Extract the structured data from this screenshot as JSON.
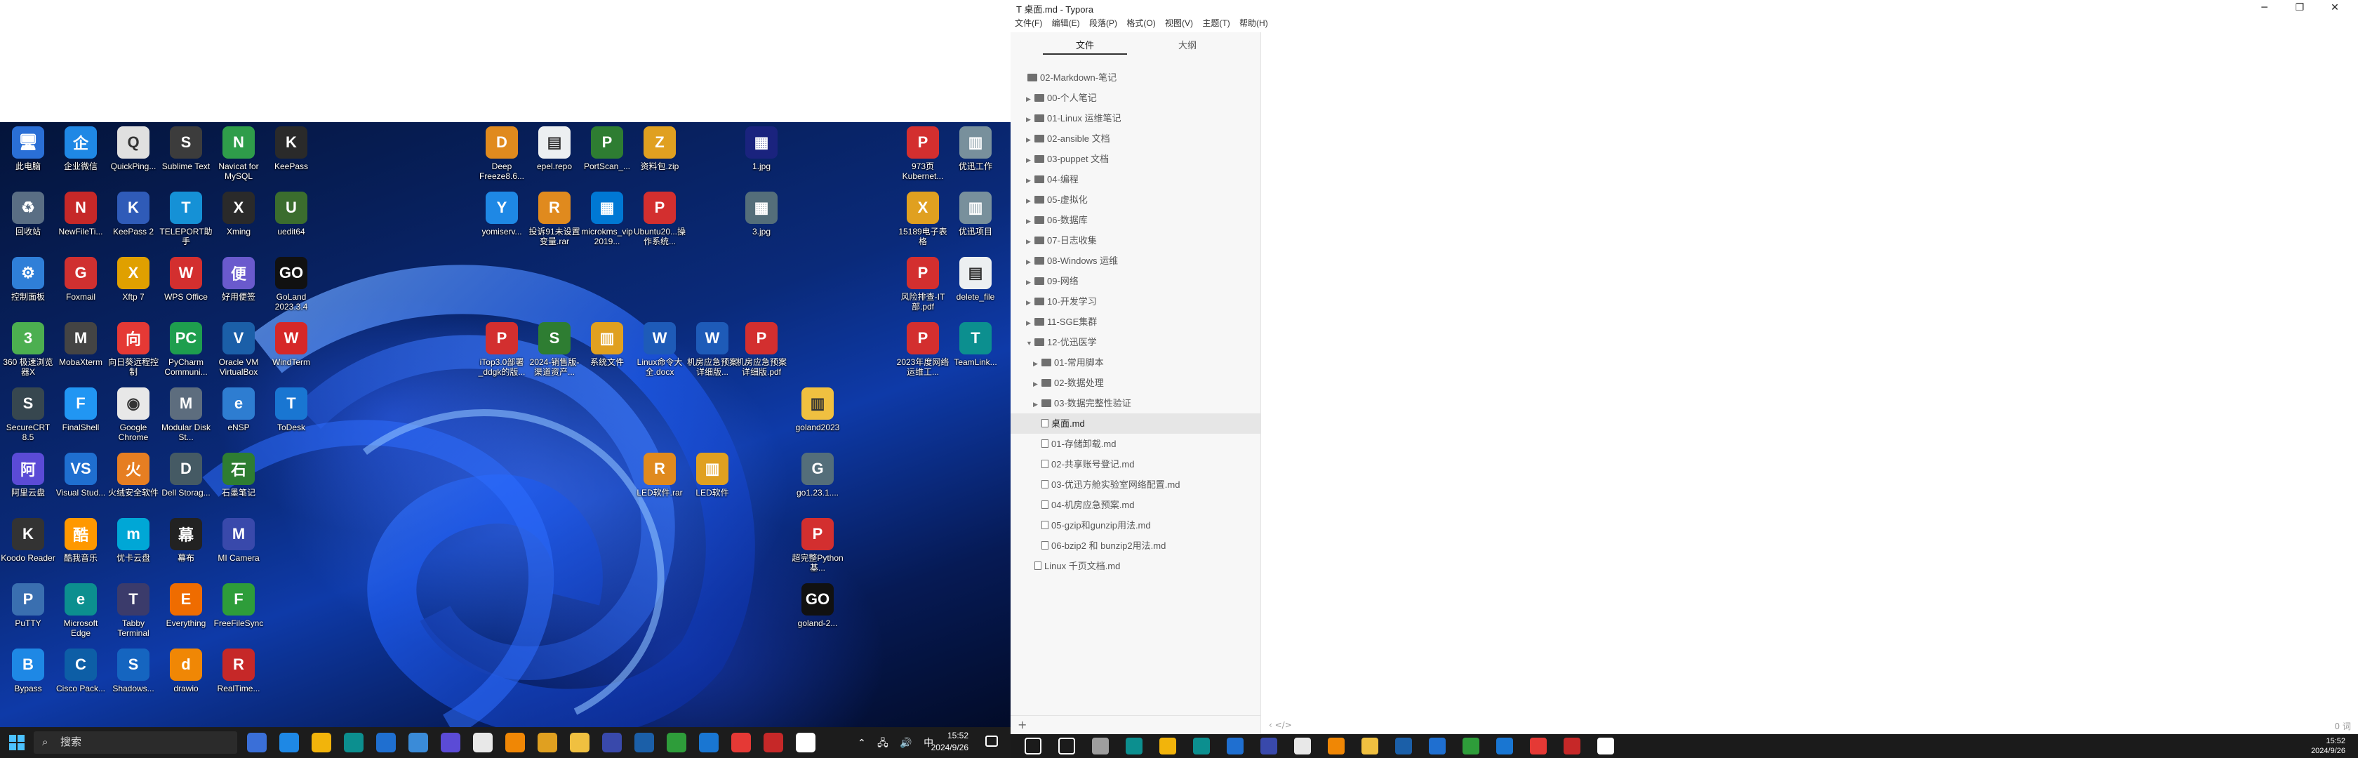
{
  "window": {
    "title": "T  桌面.md - Typora",
    "min": "─",
    "max": "❐",
    "close": "✕"
  },
  "menu": [
    "文件(F)",
    "编辑(E)",
    "段落(P)",
    "格式(O)",
    "视图(V)",
    "主题(T)",
    "帮助(H)"
  ],
  "sidebar": {
    "tabs": [
      "文件",
      "大纲"
    ],
    "tree": [
      {
        "label": "02-Markdown-笔记",
        "type": "folder",
        "depth": 0,
        "arrow": ""
      },
      {
        "label": "00-个人笔记",
        "type": "folder",
        "depth": 1,
        "arrow": "▶"
      },
      {
        "label": "01-Linux 运维笔记",
        "type": "folder",
        "depth": 1,
        "arrow": "▶"
      },
      {
        "label": "02-ansible 文档",
        "type": "folder",
        "depth": 1,
        "arrow": "▶"
      },
      {
        "label": "03-puppet 文档",
        "type": "folder",
        "depth": 1,
        "arrow": "▶"
      },
      {
        "label": "04-编程",
        "type": "folder",
        "depth": 1,
        "arrow": "▶"
      },
      {
        "label": "05-虚拟化",
        "type": "folder",
        "depth": 1,
        "arrow": "▶"
      },
      {
        "label": "06-数据库",
        "type": "folder",
        "depth": 1,
        "arrow": "▶"
      },
      {
        "label": "07-日志收集",
        "type": "folder",
        "depth": 1,
        "arrow": "▶"
      },
      {
        "label": "08-Windows 运维",
        "type": "folder",
        "depth": 1,
        "arrow": "▶"
      },
      {
        "label": "09-网络",
        "type": "folder",
        "depth": 1,
        "arrow": "▶"
      },
      {
        "label": "10-开发学习",
        "type": "folder",
        "depth": 1,
        "arrow": "▶"
      },
      {
        "label": "11-SGE集群",
        "type": "folder",
        "depth": 1,
        "arrow": "▶"
      },
      {
        "label": "12-优迅医学",
        "type": "folder",
        "depth": 1,
        "arrow": "▼"
      },
      {
        "label": "01-常用脚本",
        "type": "folder",
        "depth": 2,
        "arrow": "▶"
      },
      {
        "label": "02-数据处理",
        "type": "folder",
        "depth": 2,
        "arrow": "▶"
      },
      {
        "label": "03-数据完整性验证",
        "type": "folder",
        "depth": 2,
        "arrow": "▶"
      },
      {
        "label": "桌面.md",
        "type": "file",
        "depth": 2,
        "arrow": "",
        "selected": true
      },
      {
        "label": "01-存储卸载.md",
        "type": "file",
        "depth": 2,
        "arrow": ""
      },
      {
        "label": "02-共享账号登记.md",
        "type": "file",
        "depth": 2,
        "arrow": ""
      },
      {
        "label": "03-优迅方舱实验室网络配置.md",
        "type": "file",
        "depth": 2,
        "arrow": ""
      },
      {
        "label": "04-机房应急预案.md",
        "type": "file",
        "depth": 2,
        "arrow": ""
      },
      {
        "label": "05-gzip和gunzip用法.md",
        "type": "file",
        "depth": 2,
        "arrow": ""
      },
      {
        "label": "06-bzip2 和 bunzip2用法.md",
        "type": "file",
        "depth": 2,
        "arrow": ""
      },
      {
        "label": "Linux 千页文档.md",
        "type": "file",
        "depth": 1,
        "arrow": ""
      }
    ],
    "add": "+"
  },
  "editor_footer": {
    "left": "‹  </>",
    "right": "0 词"
  },
  "desktop_icons": [
    {
      "label": "此电脑",
      "c": "#2a6fd6",
      "g": "🖥"
    },
    {
      "label": "企业微信",
      "c": "#1f88e5",
      "g": "企"
    },
    {
      "label": "QuickPing...",
      "c": "#e0e0e0",
      "g": "Q"
    },
    {
      "label": "Sublime Text",
      "c": "#3c3c3c",
      "g": "S"
    },
    {
      "label": "Navicat for MySQL",
      "c": "#2f9d4a",
      "g": "N"
    },
    {
      "label": "KeePass",
      "c": "#2a2a2a",
      "g": "K"
    },
    {
      "label": "回收站",
      "c": "#5a6e84",
      "g": "♻"
    },
    {
      "label": "NewFileTi...",
      "c": "#c62828",
      "g": "N"
    },
    {
      "label": "KeePass 2",
      "c": "#2f5bb8",
      "g": "K"
    },
    {
      "label": "TELEPORT助手",
      "c": "#1591d6",
      "g": "T"
    },
    {
      "label": "Xming",
      "c": "#2a2a2a",
      "g": "X"
    },
    {
      "label": "uedit64",
      "c": "#3b6d2e",
      "g": "U"
    },
    {
      "label": "控制面板",
      "c": "#2f7fd8",
      "g": "⚙"
    },
    {
      "label": "Foxmail",
      "c": "#d03030",
      "g": "G"
    },
    {
      "label": "Xftp 7",
      "c": "#e0a000",
      "g": "X"
    },
    {
      "label": "WPS Office",
      "c": "#d32f2f",
      "g": "W"
    },
    {
      "label": "好用便签",
      "c": "#6a5acd",
      "g": "便"
    },
    {
      "label": "GoLand 2023.3.4",
      "c": "#111111",
      "g": "GO"
    },
    {
      "label": "360 极速浏览器X",
      "c": "#4caf50",
      "g": "3"
    },
    {
      "label": "MobaXterm",
      "c": "#444444",
      "g": "M"
    },
    {
      "label": "向日葵远程控制",
      "c": "#e53935",
      "g": "向"
    },
    {
      "label": "PyCharm Communi...",
      "c": "#1e9e4e",
      "g": "PC"
    },
    {
      "label": "Oracle VM VirtualBox",
      "c": "#1b5fa8",
      "g": "V"
    },
    {
      "label": "WindTerm",
      "c": "#d62828",
      "g": "W"
    },
    {
      "label": "SecureCRT 8.5",
      "c": "#37474f",
      "g": "S"
    },
    {
      "label": "FinalShell",
      "c": "#2196f3",
      "g": "F"
    },
    {
      "label": "Google Chrome",
      "c": "#e8e8e8",
      "g": "◉"
    },
    {
      "label": "Modular Disk St...",
      "c": "#5d6d7e",
      "g": "M"
    },
    {
      "label": "eNSP",
      "c": "#2e7dd1",
      "g": "e"
    },
    {
      "label": "ToDesk",
      "c": "#1976d2",
      "g": "T"
    },
    {
      "label": "阿里云盘",
      "c": "#5b4bd6",
      "g": "阿"
    },
    {
      "label": "Visual Stud...",
      "c": "#1f6fd0",
      "g": "VS"
    },
    {
      "label": "火绒安全软件",
      "c": "#e67e22",
      "g": "火"
    },
    {
      "label": "Dell Storag...",
      "c": "#455a64",
      "g": "D"
    },
    {
      "label": "石墨笔记",
      "c": "#2e7d32",
      "g": "石"
    },
    {
      "label": "Koodo Reader",
      "c": "#333333",
      "g": "K"
    },
    {
      "label": "酷我音乐",
      "c": "#ff9800",
      "g": "酷"
    },
    {
      "label": "优卡云盘",
      "c": "#00a7d6",
      "g": "m"
    },
    {
      "label": "幕布",
      "c": "#222222",
      "g": "幕"
    },
    {
      "label": "MI Camera",
      "c": "#3949ab",
      "g": "M"
    },
    {
      "label": "PuTTY",
      "c": "#3a6fb0",
      "g": "P"
    },
    {
      "label": "Microsoft Edge",
      "c": "#0c8f8f",
      "g": "e"
    },
    {
      "label": "Tabby Terminal",
      "c": "#3b3b6b",
      "g": "T"
    },
    {
      "label": "Everything",
      "c": "#ef6c00",
      "g": "E"
    },
    {
      "label": "FreeFileSync",
      "c": "#2e9d3a",
      "g": "F"
    },
    {
      "label": "Bypass",
      "c": "#1e88e5",
      "g": "B"
    },
    {
      "label": "Cisco Pack...",
      "c": "#0d5ea6",
      "g": "C"
    },
    {
      "label": "Shadows...",
      "c": "#1565c0",
      "g": "S"
    },
    {
      "label": "drawio",
      "c": "#f08705",
      "g": "d"
    },
    {
      "label": "RealTime...",
      "c": "#c62828",
      "g": "R"
    },
    {
      "label": "Deep Freeze8.6...",
      "c": "#e08a1e",
      "g": "D"
    },
    {
      "label": "epel.repo",
      "c": "#eceff1",
      "g": "▤"
    },
    {
      "label": "PortScan_...",
      "c": "#2e7d32",
      "g": "P"
    },
    {
      "label": "资料包.zip",
      "c": "#e0a020",
      "g": "Z"
    },
    {
      "label": "1.jpg",
      "c": "#1a237e",
      "g": "▦"
    },
    {
      "label": "973页Kubernet...",
      "c": "#d32f2f",
      "g": "P"
    },
    {
      "label": "优迅工作",
      "c": "#78909c",
      "g": "▥"
    },
    {
      "label": "yomiserv...",
      "c": "#1e88e5",
      "g": "Y"
    },
    {
      "label": "投诉91未设置变量.rar",
      "c": "#e08a1e",
      "g": "R"
    },
    {
      "label": "microkms_vip 2019...",
      "c": "#0078d4",
      "g": "▦"
    },
    {
      "label": "Ubuntu20...操作系统...",
      "c": "#d32f2f",
      "g": "P"
    },
    {
      "label": "3.jpg",
      "c": "#546e7a",
      "g": "▦"
    },
    {
      "label": "15189电子表格",
      "c": "#e0a020",
      "g": "X"
    },
    {
      "label": "优迅项目",
      "c": "#78909c",
      "g": "▥"
    },
    {
      "label": "iTop3.0部署_ddgk的版...",
      "c": "#d32f2f",
      "g": "P"
    },
    {
      "label": "2024-销售版-渠道资产...",
      "c": "#2e7d32",
      "g": "S"
    },
    {
      "label": "系统文件",
      "c": "#e0a020",
      "g": "▥"
    },
    {
      "label": "Linux命令大全.docx",
      "c": "#1e5bb8",
      "g": "W"
    },
    {
      "label": "机房应急预案详细版...",
      "c": "#1e5bb8",
      "g": "W"
    },
    {
      "label": "机房应急预案详细版.pdf",
      "c": "#d32f2f",
      "g": "P"
    },
    {
      "label": "风险排查-IT 部.pdf",
      "c": "#d32f2f",
      "g": "P"
    },
    {
      "label": "delete_file",
      "c": "#eceff1",
      "g": "▤"
    },
    {
      "label": "2023年度网络运维工...",
      "c": "#d32f2f",
      "g": "P"
    },
    {
      "label": "TeamLink...",
      "c": "#0c8f8f",
      "g": "T"
    },
    {
      "label": "goland2023",
      "c": "#f0c040",
      "g": "▥"
    },
    {
      "label": "LED软件.rar",
      "c": "#e08a1e",
      "g": "R"
    },
    {
      "label": "LED软件",
      "c": "#e0a020",
      "g": "▥"
    },
    {
      "label": "go1.23.1....",
      "c": "#546e7a",
      "g": "G"
    },
    {
      "label": "超完整Python基...",
      "c": "#d32f2f",
      "g": "P"
    },
    {
      "label": "goland-2...",
      "c": "#111111",
      "g": "GO"
    }
  ],
  "left_taskbar": {
    "search": "搜索",
    "tray": "⌃ 🖧 🔊 中",
    "time": "15:52",
    "date": "2024/9/26",
    "apps": [
      "#3a6fd8",
      "#1e88e5",
      "#f2b40b",
      "#0c8f8f",
      "#1f6fd0",
      "#3a8bd8",
      "#5b4bd6",
      "#e8e8e8",
      "#f08705",
      "#e0a020",
      "#f0c040",
      "#3949ab",
      "#1b5fa8",
      "#2e9d3a",
      "#1976d2",
      "#e53935",
      "#c62828",
      "#ffffff"
    ]
  },
  "right_taskbar": {
    "time": "15:52",
    "date": "2024/9/26",
    "apps": [
      "#ffffff",
      "#ffffff",
      "#9e9e9e",
      "#0c8f8f",
      "#f2b40b",
      "#0c8f8f",
      "#1f6fd0",
      "#3949ab",
      "#e8e8e8",
      "#f08705",
      "#f0c040",
      "#1b5fa8",
      "#1f6fd0",
      "#2e9d3a",
      "#1976d2",
      "#e53935",
      "#c62828",
      "#ffffff"
    ]
  }
}
